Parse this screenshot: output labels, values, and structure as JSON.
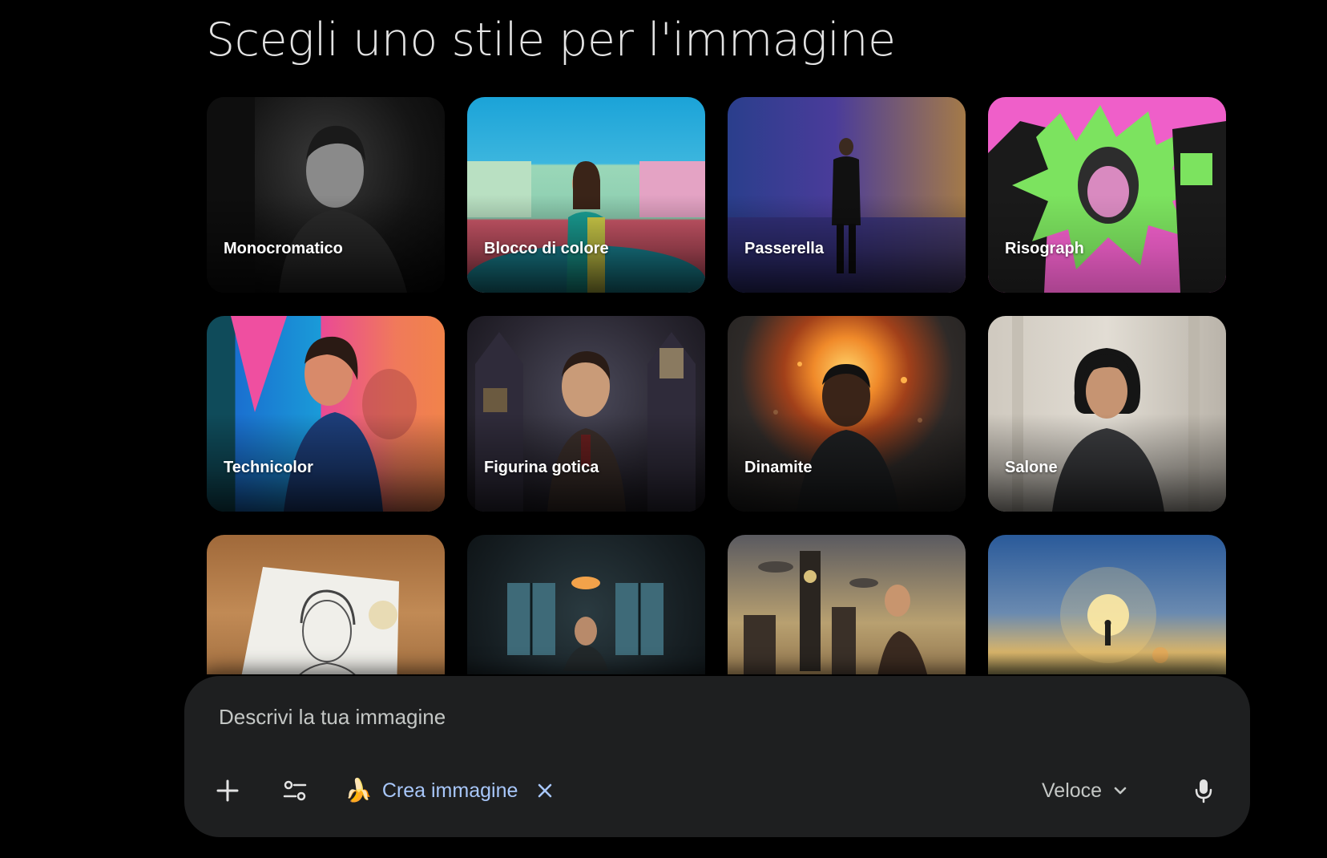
{
  "page": {
    "title": "Scegli uno stile per l'immagine"
  },
  "styles": [
    {
      "label": "Monocromatico",
      "icon": "portrait-mono"
    },
    {
      "label": "Blocco di colore",
      "icon": "portrait-colorblock"
    },
    {
      "label": "Passerella",
      "icon": "portrait-runway"
    },
    {
      "label": "Risograph",
      "icon": "portrait-risograph"
    },
    {
      "label": "Technicolor",
      "icon": "portrait-technicolor"
    },
    {
      "label": "Figurina gotica",
      "icon": "portrait-gothic"
    },
    {
      "label": "Dinamite",
      "icon": "portrait-explosion"
    },
    {
      "label": "Salone",
      "icon": "portrait-salon"
    },
    {
      "label": "",
      "icon": "pencil-sketch"
    },
    {
      "label": "",
      "icon": "dark-room"
    },
    {
      "label": "",
      "icon": "steampunk-city"
    },
    {
      "label": "",
      "icon": "sunrise-field"
    }
  ],
  "composer": {
    "placeholder": "Descrivi la tua immagine",
    "add_icon": "plus-icon",
    "tools_icon": "tune-icon",
    "chip": {
      "emoji": "🍌",
      "label": "Crea immagine",
      "close_icon": "close-icon"
    },
    "mode": {
      "label": "Veloce",
      "icon": "chevron-down-icon"
    },
    "mic_icon": "microphone-icon"
  },
  "colors": {
    "background": "#000000",
    "composer_bg": "#1e1f20",
    "chip_text": "#a8c7fa",
    "title_text": "#e3e3e3"
  }
}
